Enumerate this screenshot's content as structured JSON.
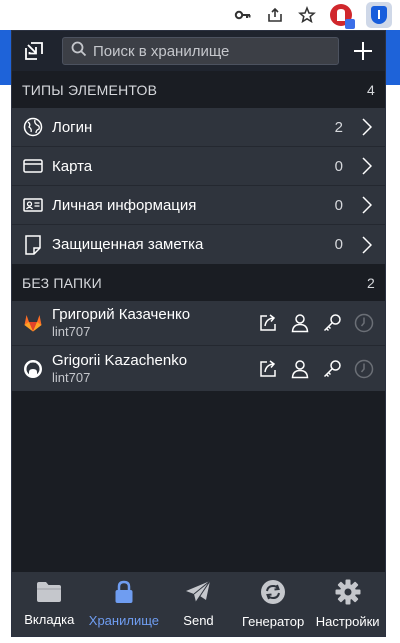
{
  "browser": {
    "icons": [
      "key-icon",
      "share-icon",
      "star-icon",
      "extension-red-icon",
      "bitwarden-extension-icon"
    ]
  },
  "header": {
    "search_placeholder": "Поиск в хранилище"
  },
  "types_section": {
    "title": "ТИПЫ ЭЛЕМЕНТОВ",
    "count": "4",
    "items": [
      {
        "label": "Логин",
        "count": "2",
        "icon": "globe-icon"
      },
      {
        "label": "Карта",
        "count": "0",
        "icon": "credit-card-icon"
      },
      {
        "label": "Личная информация",
        "count": "0",
        "icon": "id-card-icon"
      },
      {
        "label": "Защищенная заметка",
        "count": "0",
        "icon": "note-icon"
      }
    ]
  },
  "no_folder_section": {
    "title": "БЕЗ ПАПКИ",
    "count": "2",
    "items": [
      {
        "name": "Григорий Казаченко",
        "username": "lint707",
        "logo": "gitlab-logo"
      },
      {
        "name": "Grigorii Kazachenko",
        "username": "lint707",
        "logo": "github-logo"
      }
    ]
  },
  "tabs": [
    {
      "label": "Вкладка",
      "icon": "folder-icon",
      "active": false
    },
    {
      "label": "Хранилище",
      "icon": "lock-icon",
      "active": true
    },
    {
      "label": "Send",
      "icon": "send-icon",
      "active": false
    },
    {
      "label": "Генератор",
      "icon": "refresh-icon",
      "active": false
    },
    {
      "label": "Настройки",
      "icon": "gear-icon",
      "active": false
    }
  ],
  "colors": {
    "accent": "#6f9df1",
    "background": "#1a1d23",
    "list_bg": "#2f343d",
    "gitlab_orange": "#e24329"
  }
}
